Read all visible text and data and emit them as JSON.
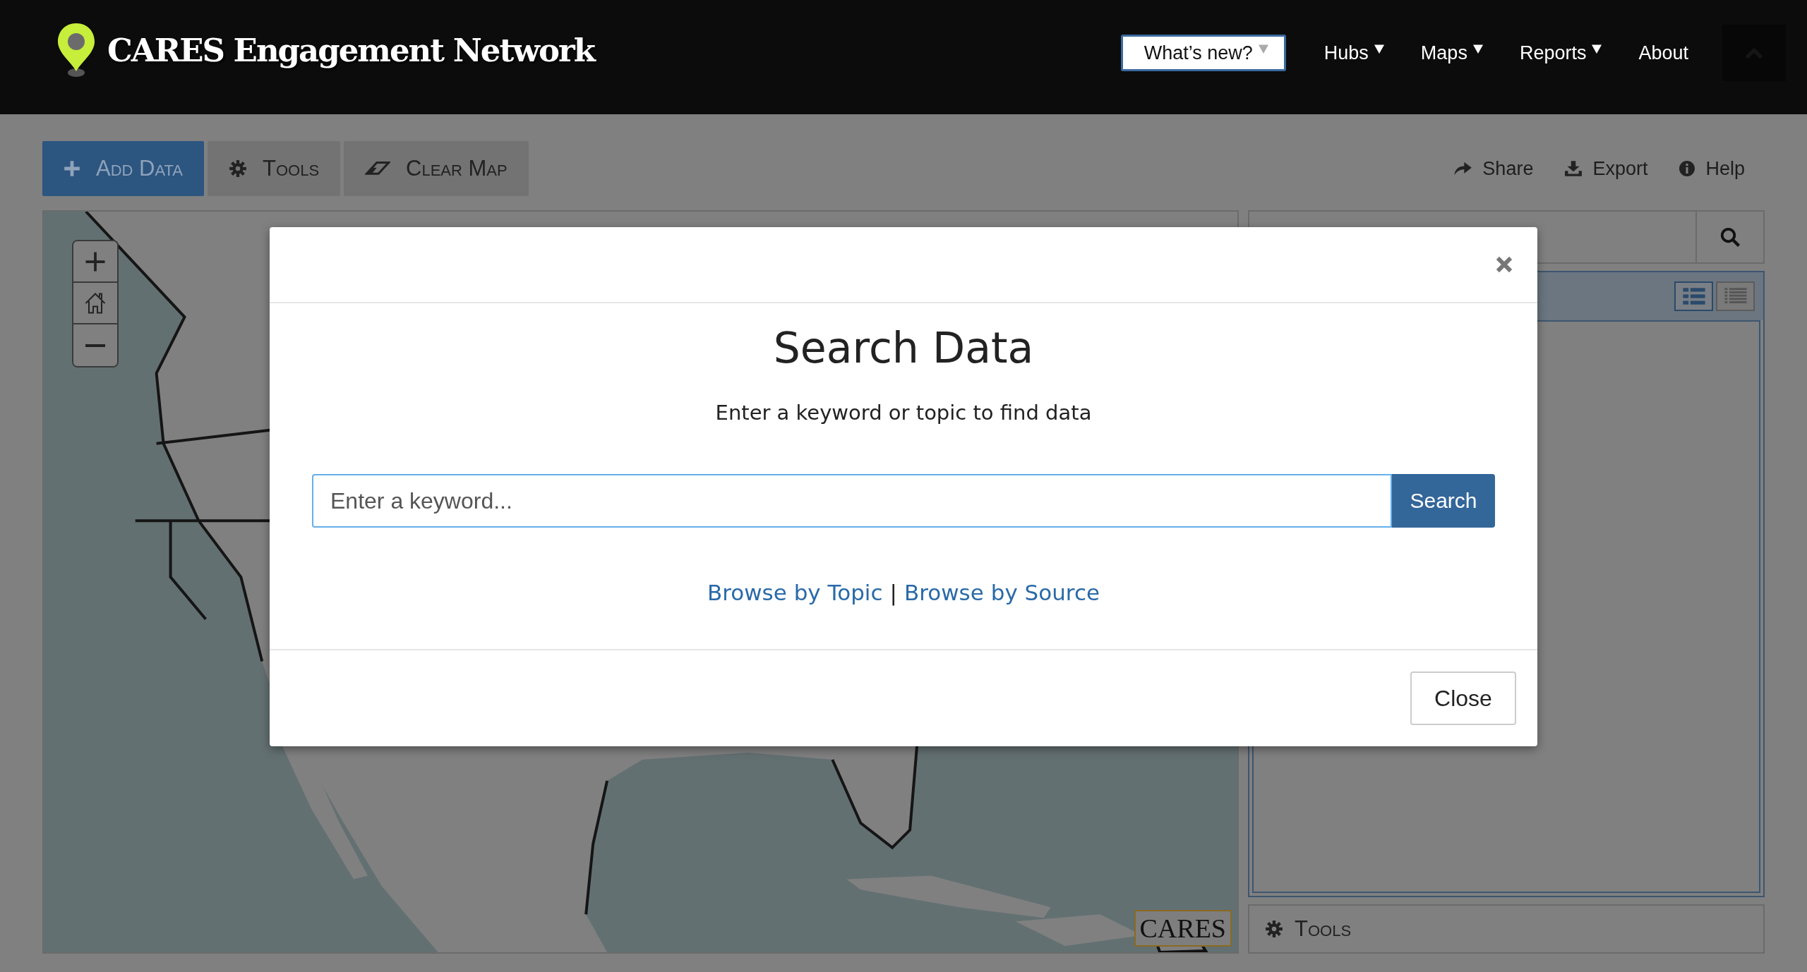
{
  "header": {
    "title": "CARES Engagement Network",
    "whats_new": {
      "label": "What’s new?"
    },
    "nav": [
      {
        "label": "Hubs",
        "kind": "dropdown"
      },
      {
        "label": "Maps",
        "kind": "dropdown"
      },
      {
        "label": "Reports",
        "kind": "dropdown"
      },
      {
        "label": "About",
        "kind": "link"
      }
    ]
  },
  "toolbar": {
    "buttons": [
      {
        "label": "Add Data",
        "kind": "add"
      },
      {
        "label": "Tools",
        "kind": "tools"
      },
      {
        "label": "Clear Map",
        "kind": "clear"
      }
    ],
    "links": [
      {
        "label": "Share",
        "kind": "share"
      },
      {
        "label": "Export",
        "kind": "export"
      },
      {
        "label": "Help",
        "kind": "help"
      }
    ]
  },
  "map": {
    "kind": "picture",
    "logo": "CARES"
  },
  "side_panel": {
    "view_toggles": [
      {
        "kind": "grid",
        "selected": true
      },
      {
        "kind": "list",
        "selected": false
      }
    ],
    "footer": {
      "label": "Tools"
    }
  },
  "modal": {
    "title": "Search Data",
    "subtitle": "Enter a keyword or topic to find data",
    "search": {
      "placeholder": "Enter a keyword...",
      "button": "Search"
    },
    "links": [
      {
        "label": "Browse by Topic"
      },
      {
        "label": "Browse by Source"
      }
    ],
    "separator": "|",
    "close_button": "Close"
  }
}
